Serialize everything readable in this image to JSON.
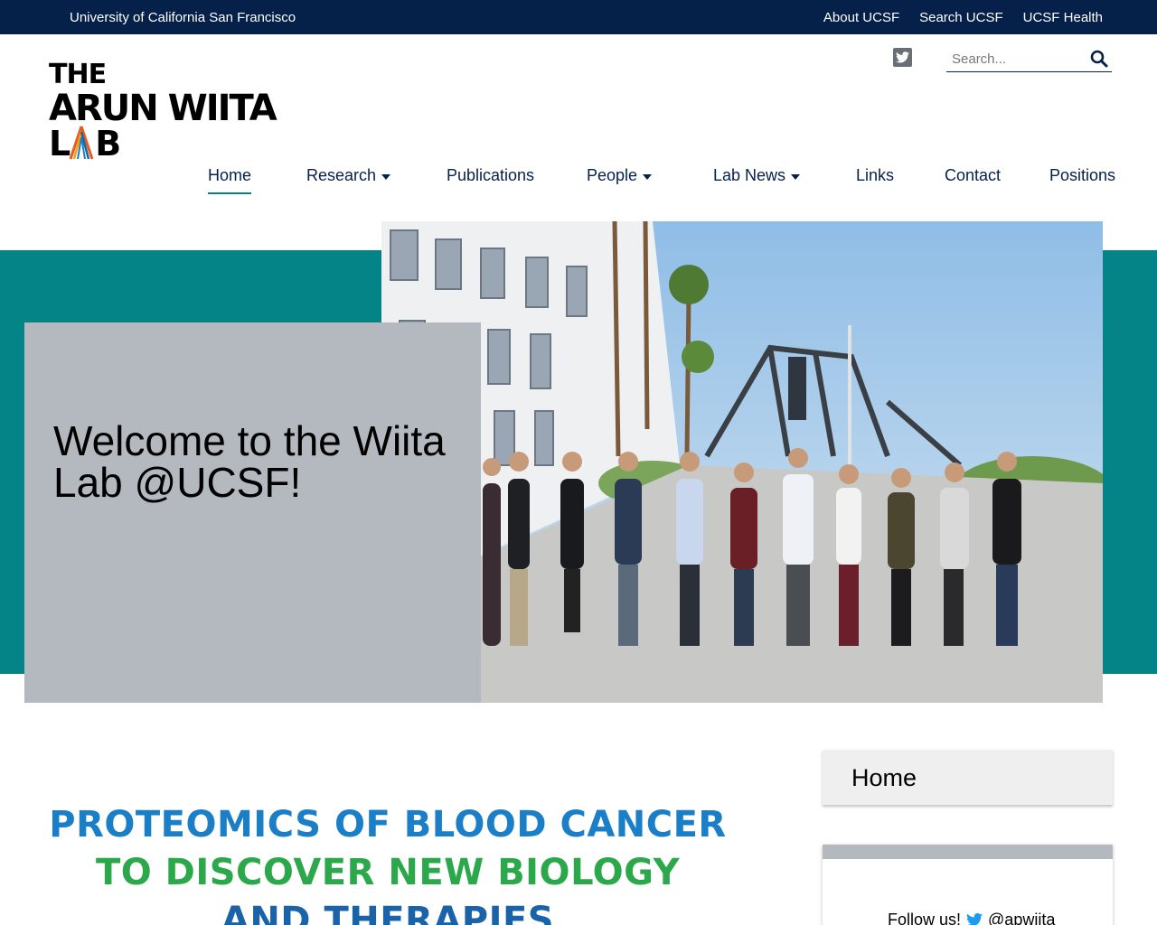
{
  "topbar": {
    "university": "University of California San Francisco",
    "links": [
      "About UCSF",
      "Search UCSF",
      "UCSF Health"
    ]
  },
  "logo": {
    "line1": "THE",
    "line2": "ARUN WIITA",
    "line3_a": "L",
    "line3_b": "B"
  },
  "header": {
    "social_icon": "twitter-icon",
    "search_placeholder": "Search...",
    "search_icon": "search-icon"
  },
  "nav": {
    "items": [
      {
        "label": "Home",
        "active": true,
        "dropdown": false
      },
      {
        "label": "Research",
        "dropdown": true
      },
      {
        "label": "Publications",
        "dropdown": false
      },
      {
        "label": "People",
        "dropdown": true
      },
      {
        "label": "Lab News",
        "dropdown": true
      },
      {
        "label": "Links",
        "dropdown": false
      },
      {
        "label": "Contact",
        "dropdown": false
      },
      {
        "label": "Positions",
        "dropdown": false
      }
    ]
  },
  "hero": {
    "heading": "Welcome to the Wiita Lab @UCSF!"
  },
  "banner": {
    "line1": "PROTEOMICS OF BLOOD CANCER",
    "line2": "TO DISCOVER NEW BIOLOGY",
    "line3": "AND THERAPIES"
  },
  "sidebar": {
    "home_label": "Home",
    "follow_text": "Follow us!",
    "twitter_handle": "@apwiita"
  },
  "colors": {
    "navy": "#052049",
    "teal": "#058488",
    "grey": "#b4b9bf",
    "banner_blue": "#1a7fc6",
    "banner_green": "#2aa84a"
  }
}
